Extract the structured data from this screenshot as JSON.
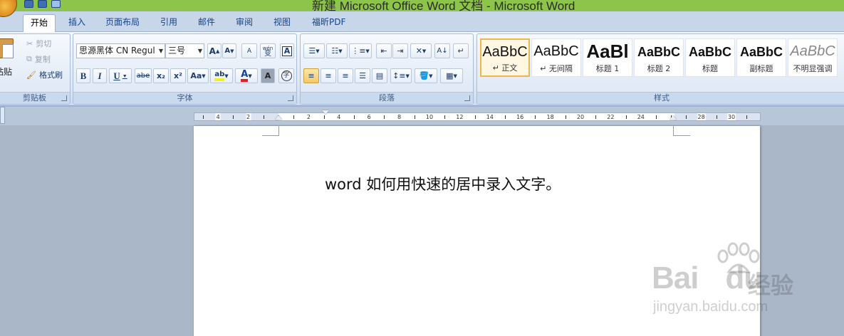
{
  "window": {
    "title": "新建 Microsoft Office Word 文档 - Microsoft Word"
  },
  "tabs": [
    "开始",
    "插入",
    "页面布局",
    "引用",
    "邮件",
    "审阅",
    "视图",
    "福昕PDF"
  ],
  "active_tab": "开始",
  "clipboard": {
    "paste_label": "粘贴",
    "cut_label": "剪切",
    "copy_label": "复制",
    "format_painter_label": "格式刷",
    "group_label": "剪贴板"
  },
  "font": {
    "font_name": "思源黑体 CN Regul",
    "font_size": "三号",
    "grow_label": "A",
    "shrink_label": "A",
    "clear_label": "A",
    "phonetic_label": "wén",
    "phonetic_char": "变",
    "border_char": "A",
    "bold": "B",
    "italic": "I",
    "underline": "U",
    "strike": "abe",
    "subscript": "x₂",
    "superscript": "x²",
    "case": "Aa",
    "highlight": "ab",
    "color": "A",
    "shading_char": "A",
    "enclose_char": "字",
    "group_label": "字体"
  },
  "paragraph": {
    "group_label": "段落"
  },
  "styles": {
    "group_label": "样式",
    "items": [
      {
        "sample": "AaBbC",
        "name": "↵ 正文",
        "selected": true
      },
      {
        "sample": "AaBbC",
        "name": "↵ 无间隔",
        "selected": false
      },
      {
        "sample": "AaBl",
        "name": "标题 1",
        "selected": false
      },
      {
        "sample": "AaBbC",
        "name": "标题 2",
        "selected": false
      },
      {
        "sample": "AaBbC",
        "name": "标题",
        "selected": false
      },
      {
        "sample": "AaBbC",
        "name": "副标题",
        "selected": false
      },
      {
        "sample": "AaBbC",
        "name": "不明显强调",
        "selected": false
      }
    ]
  },
  "ruler": {
    "labels": [
      "4",
      "2",
      "2",
      "4",
      "6",
      "8",
      "10",
      "12",
      "14",
      "16",
      "18",
      "20",
      "22",
      "24",
      "28",
      "30"
    ]
  },
  "document": {
    "text": "word 如何用快速的居中录入文字。"
  },
  "watermark": {
    "brand": "Bai",
    "brand2": "du",
    "cn": "经验",
    "url": "jingyan.baidu.com"
  },
  "colors": {
    "title_bar": "#8dc54b",
    "ribbon_bg": "#dfe8f5",
    "accent": "#f0b64a"
  }
}
